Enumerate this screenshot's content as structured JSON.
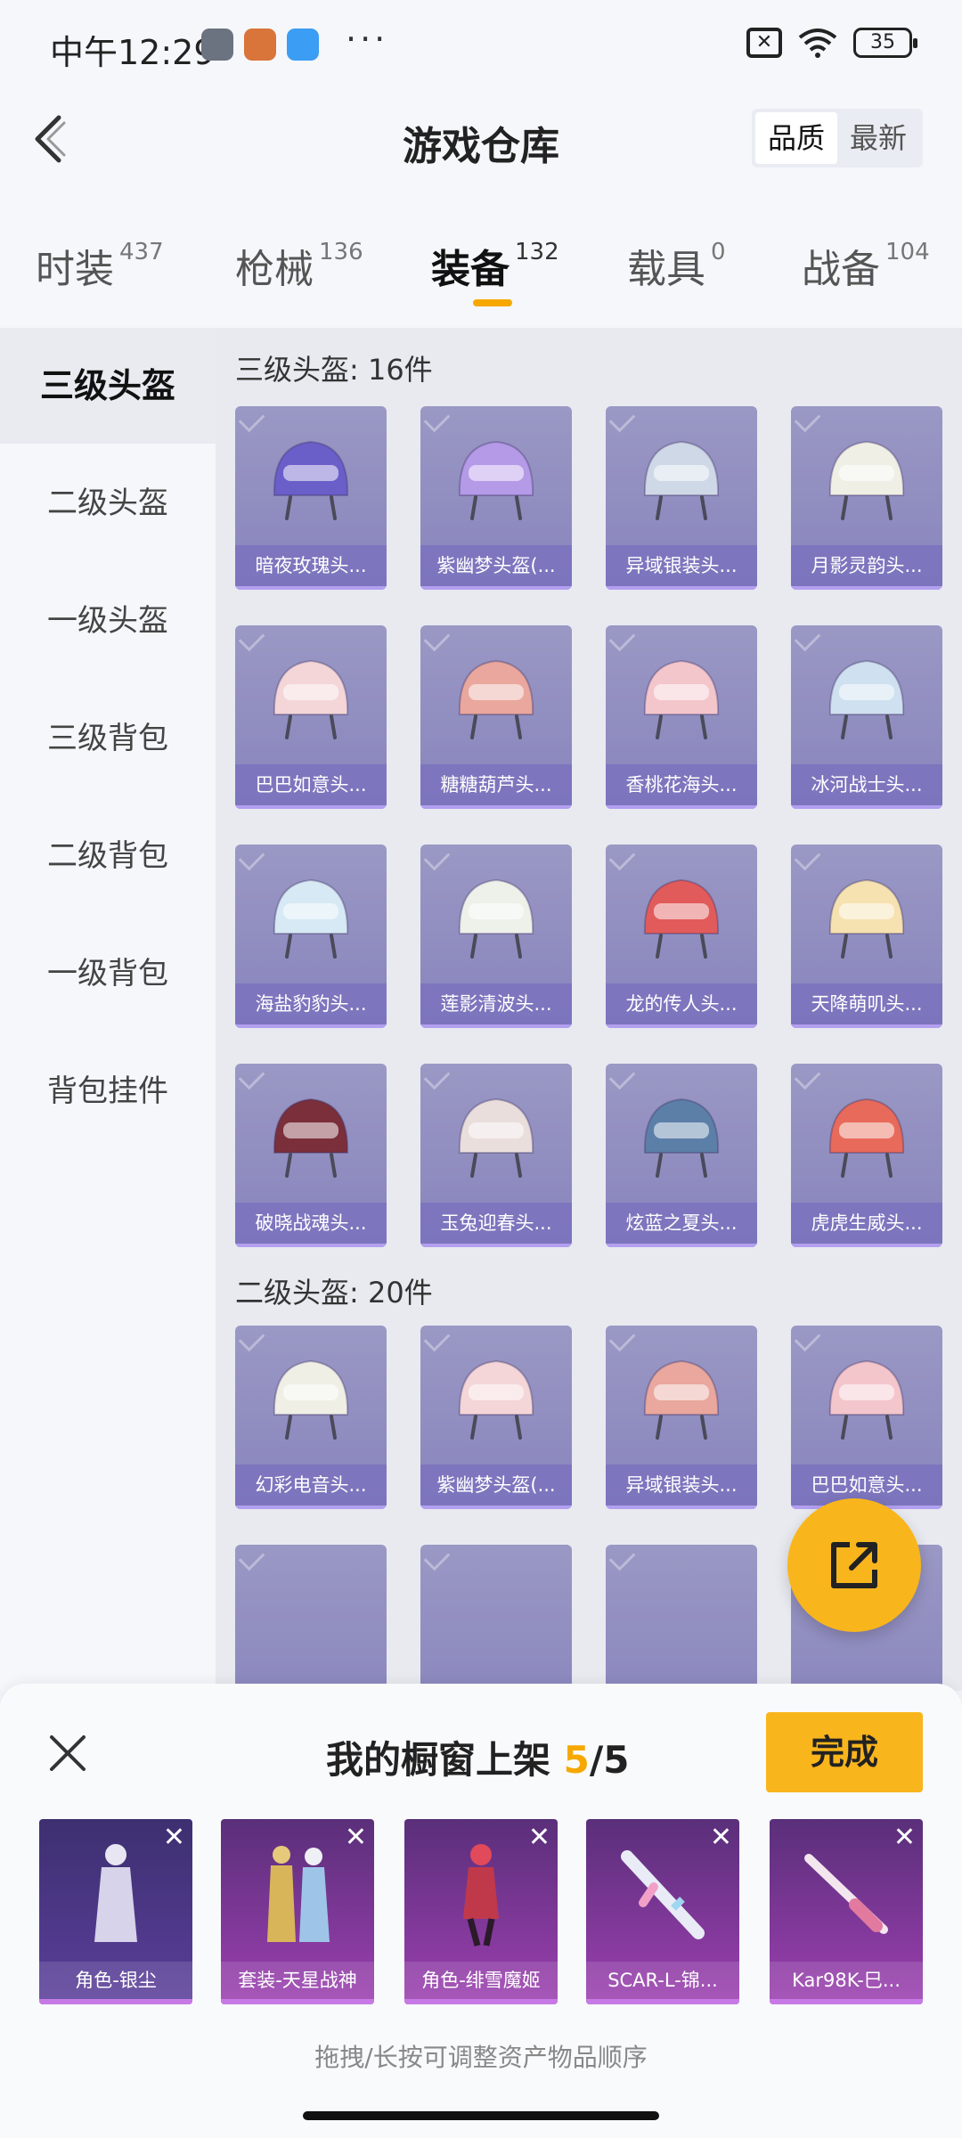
{
  "status_bar": {
    "time": "中午12:29",
    "more": "···",
    "battery": "35"
  },
  "header": {
    "title": "游戏仓库",
    "sort_options": [
      "品质",
      "最新"
    ],
    "active_sort": "品质"
  },
  "tabs": [
    {
      "label": "时装",
      "count": "437"
    },
    {
      "label": "枪械",
      "count": "136"
    },
    {
      "label": "装备",
      "count": "132"
    },
    {
      "label": "载具",
      "count": "0"
    },
    {
      "label": "战备",
      "count": "104"
    }
  ],
  "active_tab": "装备",
  "sidebar": {
    "items": [
      "三级头盔",
      "二级头盔",
      "一级头盔",
      "三级背包",
      "二级背包",
      "一级背包",
      "背包挂件"
    ],
    "active": "三级头盔"
  },
  "sections": [
    {
      "title": "三级头盔: 16件",
      "items": [
        "暗夜玫瑰头...",
        "紫幽梦头盔(...",
        "异域银装头...",
        "月影灵韵头...",
        "巴巴如意头...",
        "糖糖葫芦头...",
        "香桃花海头...",
        "冰河战士头...",
        "海盐豹豹头...",
        "莲影清波头...",
        "龙的传人头...",
        "天降萌叽头...",
        "破晓战魂头...",
        "玉兔迎春头...",
        "炫蓝之夏头...",
        "虎虎生威头..."
      ]
    },
    {
      "title": "二级头盔: 20件",
      "items": [
        "幻彩电音头...",
        "紫幽梦头盔(...",
        "异域银装头...",
        "巴巴如意头..."
      ]
    }
  ],
  "panel": {
    "title_prefix": "我的橱窗上架 ",
    "count_current": "5",
    "count_total": "/5",
    "done_label": "完成",
    "hint": "拖拽/长按可调整资产物品顺序",
    "items": [
      "角色-银尘",
      "套装-天星战神",
      "角色-绯雪魔姬",
      "SCAR-L-锦...",
      "Kar98K-巳..."
    ]
  },
  "colors": {
    "accent": "#f9b51c",
    "card_bg": "#8884bd",
    "tab_indicator": "#f6a800"
  }
}
